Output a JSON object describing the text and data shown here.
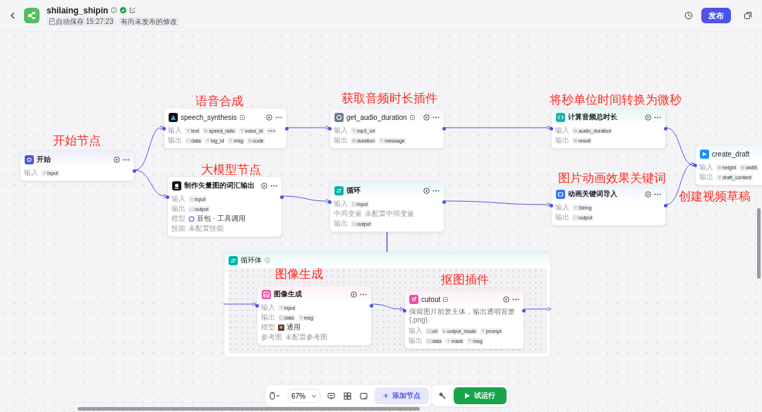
{
  "header": {
    "title": "shilaing_shipin",
    "autosave": "已自动保存 15:27:23",
    "unpublished": "有尚未发布的修改",
    "publish_button": "发布"
  },
  "annotations": [
    "开始节点",
    "语音合成",
    "获取音频时长插件",
    "将秒单位时间转换为微秒",
    "大模型节点",
    "图片动画效果关键词",
    "创建视频草稿",
    "图像生成",
    "抠图插件"
  ],
  "nodes": [
    {
      "kind": "start",
      "title": "开始",
      "plugin": false,
      "rows": [
        {
          "label": "输入",
          "kind": "tags",
          "tags": [
            {
              "kind": "str",
              "name": "input"
            }
          ]
        }
      ]
    },
    {
      "kind": "speech",
      "title": "speech_synthesis",
      "plugin": true,
      "rows": [
        {
          "label": "输入",
          "kind": "tags",
          "overflow": true,
          "tags": [
            {
              "kind": "str",
              "name": "text"
            },
            {
              "kind": "num",
              "name": "speed_ratio"
            },
            {
              "kind": "str",
              "name": "voice_id"
            }
          ]
        },
        {
          "label": "输出",
          "kind": "tags",
          "tags": [
            {
              "kind": "obj",
              "name": "data"
            },
            {
              "kind": "str",
              "name": "log_id"
            },
            {
              "kind": "str",
              "name": "msg"
            },
            {
              "kind": "num",
              "name": "code"
            }
          ]
        }
      ]
    },
    {
      "kind": "llm",
      "title": "制作矢量图的词汇输出",
      "plugin": false,
      "rows": [
        {
          "label": "输入",
          "kind": "tags",
          "tags": [
            {
              "kind": "str",
              "name": "input"
            }
          ]
        },
        {
          "label": "输出",
          "kind": "tags",
          "tags": [
            {
              "kind": "arr",
              "name": "output"
            }
          ]
        },
        {
          "label": "模型",
          "kind": "model",
          "model": {
            "kind": "llm",
            "name": "豆包 · 工具调用"
          }
        },
        {
          "label": "技能",
          "kind": "text",
          "value": "未配置技能"
        }
      ]
    },
    {
      "kind": "plugin",
      "title": "get_audio_duration",
      "plugin": true,
      "rows": [
        {
          "label": "输入",
          "kind": "tags",
          "tags": [
            {
              "kind": "str",
              "name": "mp3_url"
            }
          ]
        },
        {
          "label": "输出",
          "kind": "tags",
          "tags": [
            {
              "kind": "num",
              "name": "duration"
            },
            {
              "kind": "str",
              "name": "message"
            }
          ]
        }
      ]
    },
    {
      "kind": "loop",
      "title": "循环",
      "plugin": false,
      "rows": [
        {
          "label": "输入",
          "kind": "tags",
          "tags": [
            {
              "kind": "arr",
              "name": "input"
            }
          ]
        },
        {
          "label": "中间变量",
          "kind": "text",
          "value": "未配置中间变量"
        },
        {
          "label": "输出",
          "kind": "tags",
          "tags": [
            {
              "kind": "arr",
              "name": "output"
            }
          ]
        }
      ]
    },
    {
      "kind": "code",
      "title": "计算音频总时长",
      "plugin": false,
      "rows": [
        {
          "label": "输入",
          "kind": "tags",
          "tags": [
            {
              "kind": "num",
              "name": "audio_duration"
            }
          ]
        },
        {
          "label": "输出",
          "kind": "tags",
          "tags": [
            {
              "kind": "num",
              "name": "result"
            }
          ]
        }
      ]
    },
    {
      "kind": "keyword",
      "title": "动画关键词导入",
      "plugin": false,
      "rows": [
        {
          "label": "输入",
          "kind": "tags",
          "tags": [
            {
              "kind": "str",
              "name": "String"
            }
          ]
        },
        {
          "label": "输出",
          "kind": "tags",
          "tags": [
            {
              "kind": "arr",
              "name": "output"
            }
          ]
        }
      ]
    },
    {
      "kind": "draft",
      "title": "create_draft",
      "plugin": true,
      "rows": [
        {
          "label": "输入",
          "kind": "tags",
          "tags": [
            {
              "kind": "num",
              "name": "height"
            },
            {
              "kind": "num",
              "name": "width"
            }
          ]
        },
        {
          "label": "输出",
          "kind": "tags",
          "tags": [
            {
              "kind": "str",
              "name": "draft_content"
            }
          ]
        }
      ]
    }
  ],
  "loop_body": {
    "title": "循环体",
    "nodes": [
      {
        "kind": "image",
        "title": "图像生成",
        "plugin": false,
        "rows": [
          {
            "label": "输入",
            "kind": "tags",
            "tags": [
              {
                "kind": "str",
                "name": "input"
              }
            ]
          },
          {
            "label": "输出",
            "kind": "tags",
            "tags": [
              {
                "kind": "img",
                "name": "data"
              },
              {
                "kind": "str",
                "name": "msg"
              }
            ]
          },
          {
            "label": "模型",
            "kind": "model",
            "model": {
              "kind": "image",
              "name": "通用"
            }
          },
          {
            "label": "参考图",
            "kind": "text",
            "value": "未配置参考图"
          }
        ]
      },
      {
        "kind": "cutout",
        "title": "cutout",
        "plugin": true,
        "description": "保留图片前景主体，输出透明背景(.png)",
        "rows": [
          {
            "label": "输入",
            "kind": "tags",
            "tags": [
              {
                "kind": "img",
                "name": "url"
              },
              {
                "kind": "num",
                "name": "output_mode"
              },
              {
                "kind": "str",
                "name": "prompt"
              }
            ]
          },
          {
            "label": "输出",
            "kind": "tags",
            "tags": [
              {
                "kind": "img",
                "name": "data"
              },
              {
                "kind": "str",
                "name": "mask"
              },
              {
                "kind": "str",
                "name": "msg"
              }
            ]
          }
        ]
      }
    ]
  },
  "toolbar": {
    "zoom": "67%",
    "add_node": "添加节点",
    "run": "试运行"
  }
}
